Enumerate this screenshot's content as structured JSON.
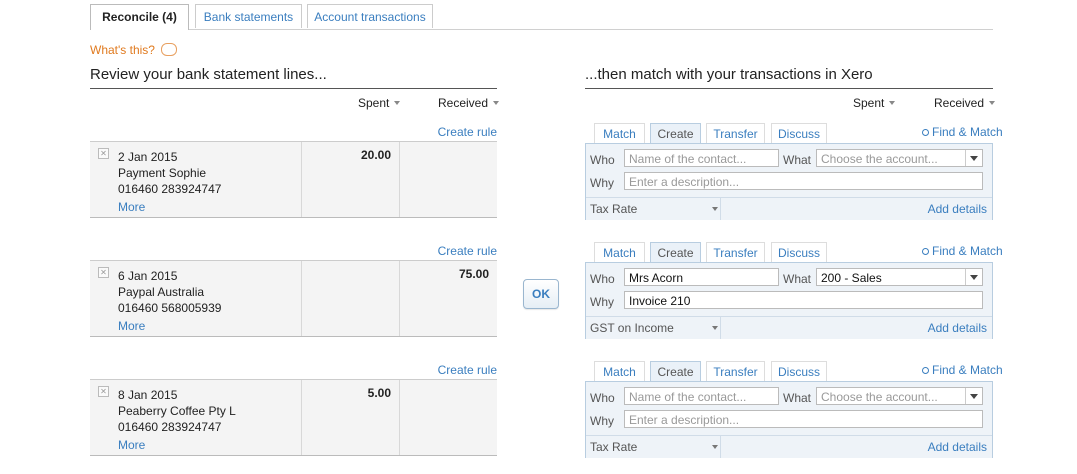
{
  "tabs": [
    {
      "label": "Reconcile (4)",
      "active": true
    },
    {
      "label": "Bank statements",
      "active": false
    },
    {
      "label": "Account transactions",
      "active": false
    }
  ],
  "whats_this": "What's this?",
  "left_title": "Review your bank statement lines...",
  "right_title": "...then match with your transactions in Xero",
  "columns": {
    "spent": "Spent",
    "received": "Received"
  },
  "create_rule": "Create rule",
  "ok_label": "OK",
  "match_tabs": [
    "Match",
    "Create",
    "Transfer",
    "Discuss"
  ],
  "find_match": "Find & Match",
  "labels": {
    "who": "Who",
    "what": "What",
    "why": "Why",
    "add_details": "Add details"
  },
  "statements": [
    {
      "date": "2 Jan 2015",
      "payee": "Payment Sophie",
      "ref": "016460 283924747",
      "more": "More",
      "spent": "20.00",
      "received": ""
    },
    {
      "date": "6 Jan 2015",
      "payee": "Paypal Australia",
      "ref": "016460 568005939",
      "more": "More",
      "spent": "",
      "received": "75.00"
    },
    {
      "date": "8 Jan 2015",
      "payee": "Peaberry Coffee Pty L",
      "ref": "016460 283924747",
      "more": "More",
      "spent": "5.00",
      "received": ""
    }
  ],
  "forms": [
    {
      "who_placeholder": "Name of the contact...",
      "who_value": "",
      "what_placeholder": "Choose the account...",
      "what_value": "",
      "why_placeholder": "Enter a description...",
      "why_value": "",
      "tax": "Tax Rate"
    },
    {
      "who_placeholder": "",
      "who_value": "Mrs Acorn",
      "what_placeholder": "",
      "what_value": "200 - Sales",
      "why_placeholder": "",
      "why_value": "Invoice 210",
      "tax": "GST on Income"
    },
    {
      "who_placeholder": "Name of the contact...",
      "who_value": "",
      "what_placeholder": "Choose the account...",
      "what_value": "",
      "why_placeholder": "Enter a description...",
      "why_value": "",
      "tax": "Tax Rate"
    }
  ],
  "colors": {
    "link": "#3a7ebf",
    "panel_bg": "#eef3f8",
    "whats_this": "#e07a1f"
  },
  "icons": [
    "remove-icon",
    "speech-bubble-icon",
    "magnifier-icon",
    "caret-down-icon"
  ]
}
